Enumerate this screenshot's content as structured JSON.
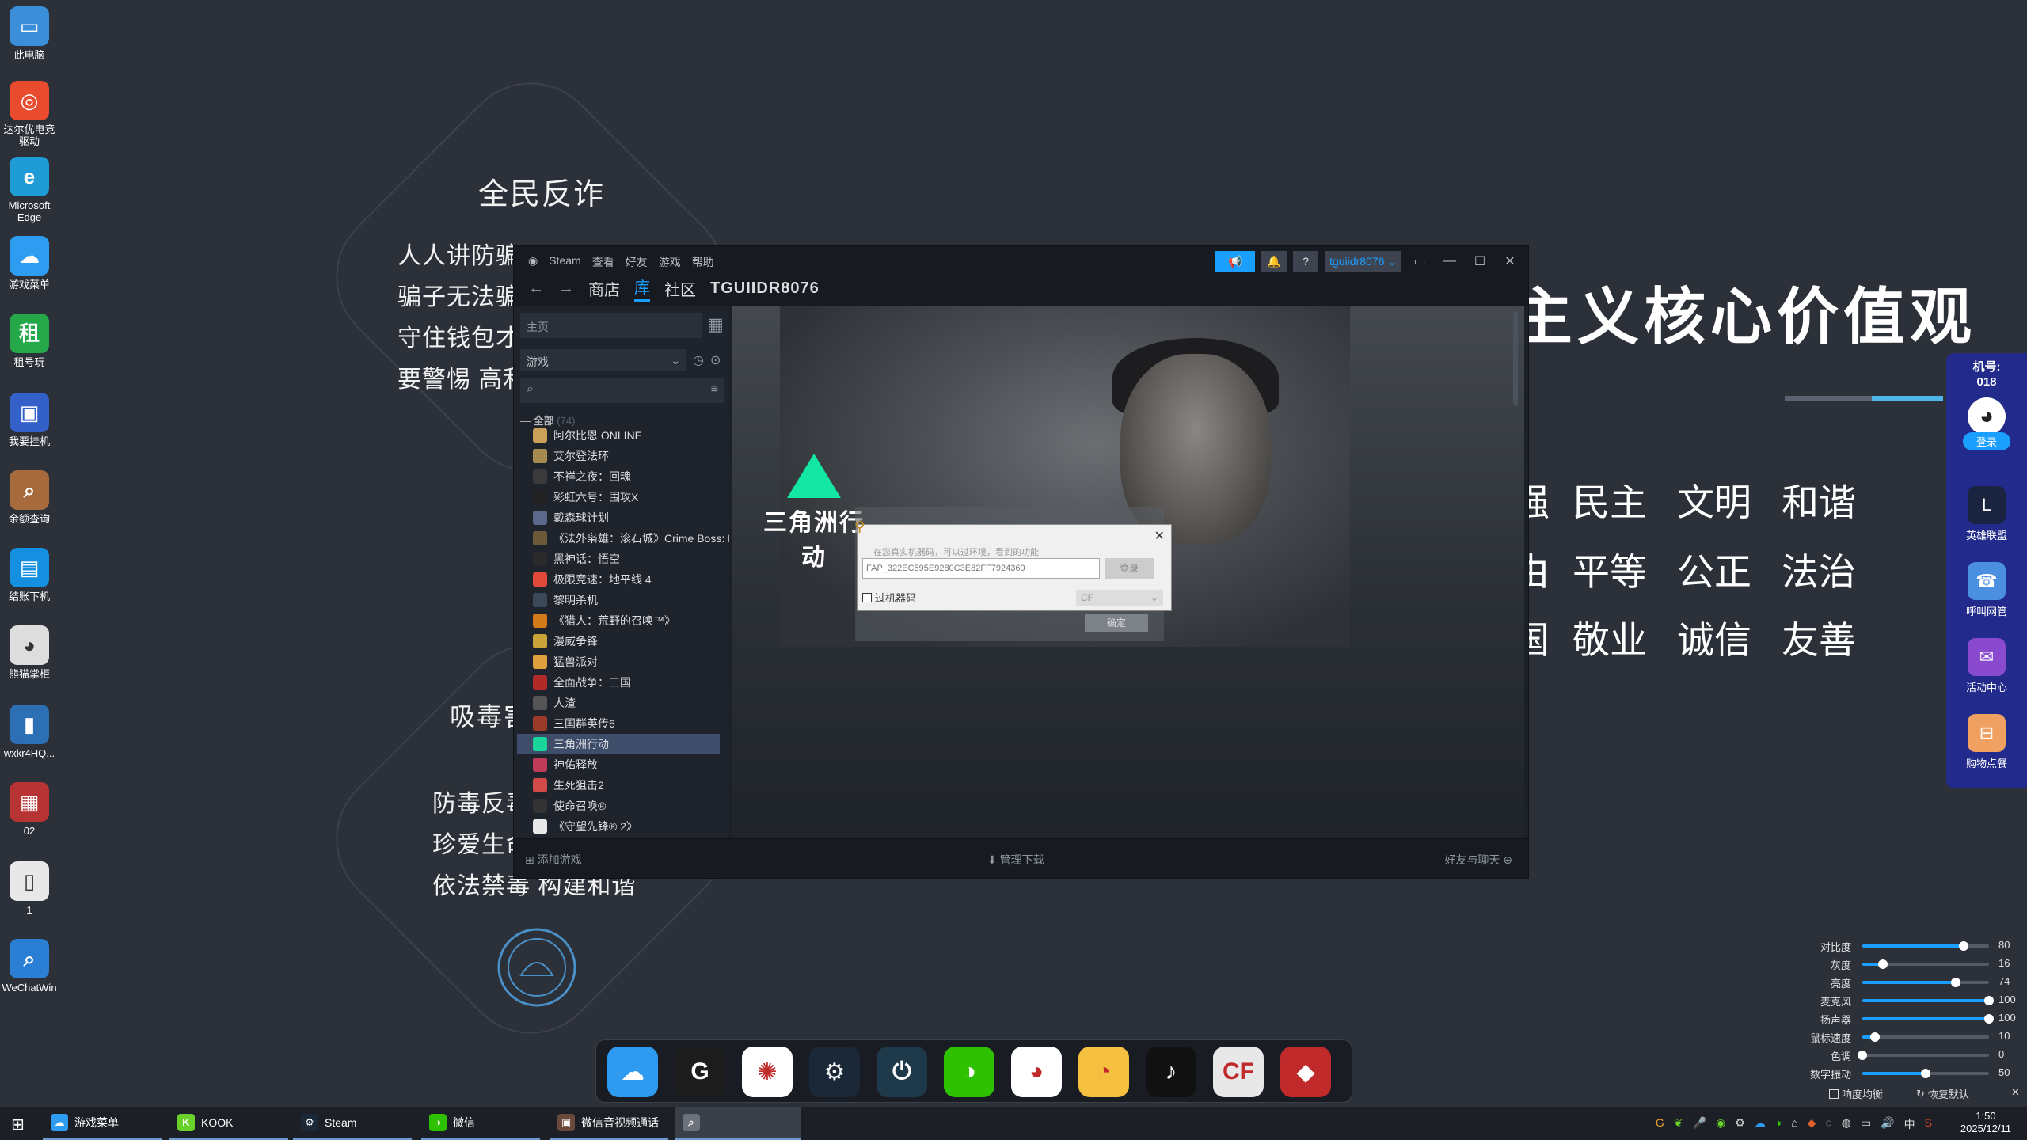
{
  "wallpaper": {
    "left_top_title": "全民反诈",
    "left_top_lines": [
      "人人讲防骗",
      "骗子无法骗",
      "守住钱包才",
      "要警惕 高利"
    ],
    "left_bottom_title": "吸毒害",
    "left_bottom_lines": [
      "防毒反毒",
      "珍爱生命",
      "依法禁毒  构建和谐"
    ],
    "big_title": "主义核心价值观",
    "values_row1": [
      "强",
      "民主",
      "文明",
      "和谐"
    ],
    "values_row2": [
      "由",
      "平等",
      "公正",
      "法治"
    ],
    "values_row3": [
      "国",
      "敬业",
      "诚信",
      "友善"
    ]
  },
  "desktop_icons": [
    {
      "label": "此电脑",
      "color": "#3b8fd9",
      "glyph": "▭"
    },
    {
      "label": "达尔优电竞驱动",
      "color": "#e94b2f",
      "glyph": "◎"
    },
    {
      "label": "Microsoft Edge",
      "color": "#1f9bd6",
      "glyph": "e"
    },
    {
      "label": "游戏菜单",
      "color": "#2e9cf0",
      "glyph": "☁"
    },
    {
      "label": "租号玩",
      "color": "#24a84a",
      "glyph": "租"
    },
    {
      "label": "我要挂机",
      "color": "#3461c9",
      "glyph": "▣"
    },
    {
      "label": "余额查询",
      "color": "#a66a3d",
      "glyph": "⌕"
    },
    {
      "label": "结账下机",
      "color": "#1590e0",
      "glyph": "▤"
    },
    {
      "label": "熊猫掌柜",
      "color": "#dddddd",
      "glyph": "◕"
    },
    {
      "label": "wxkr4HQ...",
      "color": "#2d6fb5",
      "glyph": "▮"
    },
    {
      "label": "02",
      "color": "#b83434",
      "glyph": "▦"
    },
    {
      "label": "1",
      "color": "#e8e8e8",
      "glyph": "▯"
    },
    {
      "label": "WeChatWin",
      "color": "#2a7fd4",
      "glyph": "⌕"
    }
  ],
  "steam": {
    "menu": [
      "Steam",
      "查看",
      "好友",
      "游戏",
      "帮助"
    ],
    "tabs": {
      "store": "商店",
      "library": "库",
      "community": "社区",
      "user": "TGUIIDR8076"
    },
    "account_name": "tguiidr8076 ⌄",
    "help_label": "?",
    "home_label": "主页",
    "category_label": "游戏",
    "all_label": "全部",
    "all_count": "(74)",
    "games": [
      {
        "name": "阿尔比恩 ONLINE",
        "color": "#c9a25a"
      },
      {
        "name": "艾尔登法环",
        "color": "#a58b4f"
      },
      {
        "name": "不祥之夜：回魂",
        "color": "#3a3a3a"
      },
      {
        "name": "彩虹六号：围攻X",
        "color": "#222222"
      },
      {
        "name": "戴森球计划",
        "color": "#5b6a8a"
      },
      {
        "name": "《法外枭雄：滚石城》Crime Boss: R",
        "color": "#6a5a3a"
      },
      {
        "name": "黑神话：悟空",
        "color": "#2a2a2a"
      },
      {
        "name": "极限竞速：地平线 4",
        "color": "#e04a3a"
      },
      {
        "name": "黎明杀机",
        "color": "#3a4a5a"
      },
      {
        "name": "《猎人：荒野的召唤™》",
        "color": "#d07a1a"
      },
      {
        "name": "漫威争锋",
        "color": "#c9a23a"
      },
      {
        "name": "猛兽派对",
        "color": "#e0a040"
      },
      {
        "name": "全面战争：三国",
        "color": "#b02a2a"
      },
      {
        "name": "人渣",
        "color": "#555555"
      },
      {
        "name": "三国群英传6",
        "color": "#9a3a2a"
      },
      {
        "name": "三角洲行动",
        "color": "#1bd69b"
      },
      {
        "name": "神佑释放",
        "color": "#c03a5a"
      },
      {
        "name": "生死狙击2",
        "color": "#d04a4a"
      },
      {
        "name": "使命召唤®",
        "color": "#333333"
      },
      {
        "name": "《守望先锋® 2》",
        "color": "#e8e8e8"
      }
    ],
    "selected_game_index": 15,
    "hero_logo": "三角洲行动",
    "bottom_add": "添加游戏",
    "bottom_downloads": "管理下载",
    "bottom_friends": "好友与聊天"
  },
  "dialog": {
    "hint": "在您真实机器码，可以过环境，看到的功能",
    "code_value": "FAP_322EC595E9280C3E82FF7924360",
    "login_label": "登录",
    "checkbox_label": "过机器码",
    "select_value": "CF",
    "ok_label": "确定"
  },
  "right_panel": {
    "machine_label": "机号:",
    "machine_number": "018",
    "login_label": "登录",
    "items": [
      {
        "label": "英雄联盟",
        "color": "#1a2440",
        "glyph": "L"
      },
      {
        "label": "呼叫网管",
        "color": "#4a8fe0",
        "glyph": "☎"
      },
      {
        "label": "活动中心",
        "color": "#8a4ad0",
        "glyph": "✉"
      },
      {
        "label": "购物点餐",
        "color": "#f0a060",
        "glyph": "⊟"
      }
    ]
  },
  "sliders": [
    {
      "label": "对比度",
      "value": 80
    },
    {
      "label": "灰度",
      "value": 16
    },
    {
      "label": "亮度",
      "value": 74
    },
    {
      "label": "麦克风",
      "value": 100
    },
    {
      "label": "扬声器",
      "value": 100
    },
    {
      "label": "鼠标速度",
      "value": 10
    },
    {
      "label": "色调",
      "value": 0
    },
    {
      "label": "数字振动",
      "value": 50
    }
  ],
  "system_options": {
    "balance": "响度均衡",
    "restore": "恢复默认"
  },
  "dock": [
    {
      "name": "cloud",
      "color": "#2f9bf0",
      "glyph": "☁"
    },
    {
      "name": "g-app",
      "color": "#1c1c1c",
      "glyph": "G"
    },
    {
      "name": "pinwheel",
      "color": "#ffffff",
      "glyph": "✺"
    },
    {
      "name": "steam",
      "color": "#1b2838",
      "glyph": "⚙"
    },
    {
      "name": "power-app",
      "color": "#1e3a4a",
      "glyph": "⏻"
    },
    {
      "name": "wechat",
      "color": "#2dc100",
      "glyph": "◑"
    },
    {
      "name": "qq",
      "color": "#ffffff",
      "glyph": "◕"
    },
    {
      "name": "cat-app",
      "color": "#f5c040",
      "glyph": "◔"
    },
    {
      "name": "tiktok",
      "color": "#111111",
      "glyph": "♪"
    },
    {
      "name": "crossfire",
      "color": "#e8e8e8",
      "glyph": "CF"
    },
    {
      "name": "red-game",
      "color": "#c02a2a",
      "glyph": "◆"
    }
  ],
  "taskbar": {
    "items": [
      {
        "label": "游戏菜单",
        "color": "#2e9cf0",
        "glyph": "☁"
      },
      {
        "label": "KOOK",
        "color": "#6ad12a",
        "glyph": "K"
      },
      {
        "label": "Steam",
        "color": "#1b2838",
        "glyph": "⚙"
      },
      {
        "label": "微信",
        "color": "#2dc100",
        "glyph": "◑"
      },
      {
        "label": "微信音视频通话",
        "color": "#6a4a3a",
        "glyph": "▣"
      },
      {
        "label": "",
        "color": "#6d727a",
        "glyph": "⌕"
      }
    ],
    "ime": "中",
    "time": "1:50",
    "date": "2025/12/11"
  }
}
